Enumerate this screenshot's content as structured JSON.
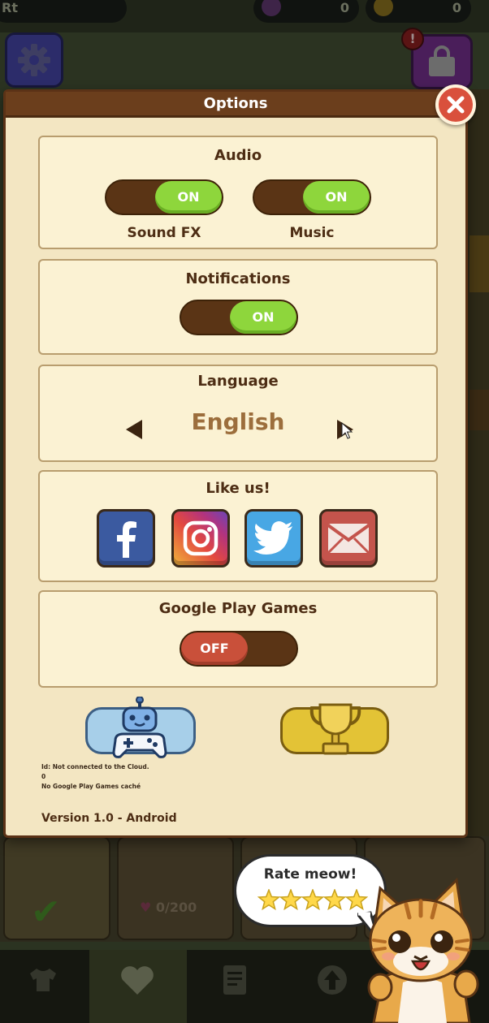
{
  "background": {
    "top_pill_left_text": "Rt",
    "top_pill_mid_value": "0",
    "top_pill_right_value": "0",
    "alert_badge": "!",
    "hearts_counter": "0/200"
  },
  "dialog": {
    "title": "Options",
    "audio": {
      "title": "Audio",
      "sound_fx": {
        "label": "Sound FX",
        "state": "ON"
      },
      "music": {
        "label": "Music",
        "state": "ON"
      }
    },
    "notifications": {
      "title": "Notifications",
      "state": "ON"
    },
    "language": {
      "title": "Language",
      "value": "English"
    },
    "like_us": {
      "title": "Like us!",
      "buttons": [
        {
          "name": "facebook",
          "icon": "facebook-icon",
          "color": "#3b5aa0"
        },
        {
          "name": "instagram",
          "icon": "instagram-icon",
          "color": "#c7376d"
        },
        {
          "name": "twitter",
          "icon": "twitter-icon",
          "color": "#48a7e4"
        },
        {
          "name": "email",
          "icon": "mail-icon",
          "color": "#c4544c"
        }
      ]
    },
    "google_play_games": {
      "title": "Google Play Games",
      "state": "OFF"
    },
    "cloud_status_lines": [
      "Id: Not connected to the Cloud.",
      "0",
      "No Google Play Games caché"
    ],
    "version": "Version 1.0 - Android"
  },
  "rate": {
    "title": "Rate meow!",
    "stars": 5
  },
  "colors": {
    "toggle_on": "#8ed63c",
    "toggle_off": "#c9503a",
    "panel": "#f3e6c2",
    "header": "#6b3e1c"
  }
}
